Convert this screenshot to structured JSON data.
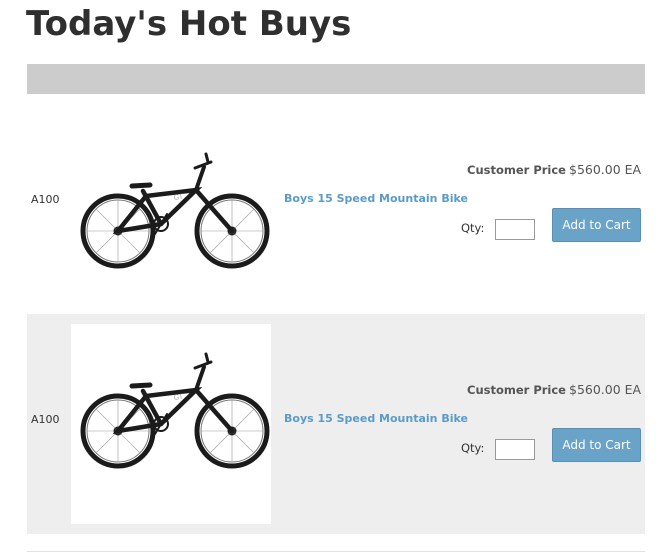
{
  "page": {
    "title": "Today's Hot Buys"
  },
  "products": [
    {
      "sku": "A100",
      "name": "Boys 15 Speed Mountain Bike",
      "price_label": "Customer Price",
      "price": "$560.00 EA",
      "qty_label": "Qty:",
      "qty_value": "",
      "add_label": "Add to Cart",
      "image_icon": "bmx-bike-image"
    },
    {
      "sku": "A100",
      "name": "Boys 15 Speed Mountain Bike",
      "price_label": "Customer Price",
      "price": "$560.00 EA",
      "qty_label": "Qty:",
      "qty_value": "",
      "add_label": "Add to Cart",
      "image_icon": "bmx-bike-image"
    }
  ],
  "colors": {
    "link": "#5b9bc8",
    "button": "#6aa3c8",
    "header_bar": "#cccccc",
    "alt_row": "#eeeeee"
  }
}
